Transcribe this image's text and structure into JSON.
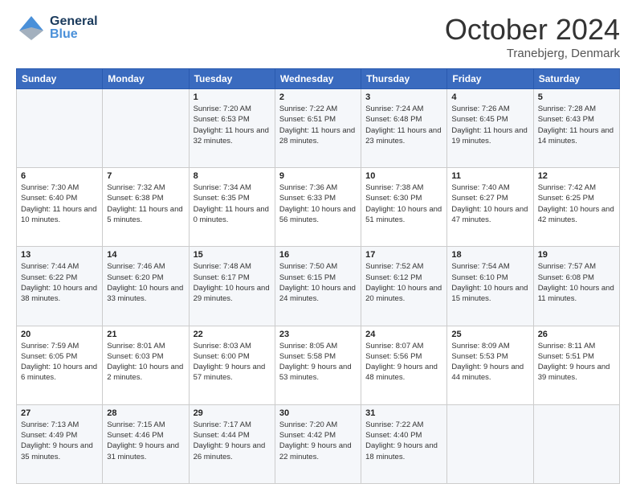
{
  "header": {
    "logo_general": "General",
    "logo_blue": "Blue",
    "month_title": "October 2024",
    "location": "Tranebjerg, Denmark"
  },
  "calendar": {
    "days_of_week": [
      "Sunday",
      "Monday",
      "Tuesday",
      "Wednesday",
      "Thursday",
      "Friday",
      "Saturday"
    ],
    "weeks": [
      [
        {
          "day": "",
          "sunrise": "",
          "sunset": "",
          "daylight": ""
        },
        {
          "day": "",
          "sunrise": "",
          "sunset": "",
          "daylight": ""
        },
        {
          "day": "1",
          "sunrise": "Sunrise: 7:20 AM",
          "sunset": "Sunset: 6:53 PM",
          "daylight": "Daylight: 11 hours and 32 minutes."
        },
        {
          "day": "2",
          "sunrise": "Sunrise: 7:22 AM",
          "sunset": "Sunset: 6:51 PM",
          "daylight": "Daylight: 11 hours and 28 minutes."
        },
        {
          "day": "3",
          "sunrise": "Sunrise: 7:24 AM",
          "sunset": "Sunset: 6:48 PM",
          "daylight": "Daylight: 11 hours and 23 minutes."
        },
        {
          "day": "4",
          "sunrise": "Sunrise: 7:26 AM",
          "sunset": "Sunset: 6:45 PM",
          "daylight": "Daylight: 11 hours and 19 minutes."
        },
        {
          "day": "5",
          "sunrise": "Sunrise: 7:28 AM",
          "sunset": "Sunset: 6:43 PM",
          "daylight": "Daylight: 11 hours and 14 minutes."
        }
      ],
      [
        {
          "day": "6",
          "sunrise": "Sunrise: 7:30 AM",
          "sunset": "Sunset: 6:40 PM",
          "daylight": "Daylight: 11 hours and 10 minutes."
        },
        {
          "day": "7",
          "sunrise": "Sunrise: 7:32 AM",
          "sunset": "Sunset: 6:38 PM",
          "daylight": "Daylight: 11 hours and 5 minutes."
        },
        {
          "day": "8",
          "sunrise": "Sunrise: 7:34 AM",
          "sunset": "Sunset: 6:35 PM",
          "daylight": "Daylight: 11 hours and 0 minutes."
        },
        {
          "day": "9",
          "sunrise": "Sunrise: 7:36 AM",
          "sunset": "Sunset: 6:33 PM",
          "daylight": "Daylight: 10 hours and 56 minutes."
        },
        {
          "day": "10",
          "sunrise": "Sunrise: 7:38 AM",
          "sunset": "Sunset: 6:30 PM",
          "daylight": "Daylight: 10 hours and 51 minutes."
        },
        {
          "day": "11",
          "sunrise": "Sunrise: 7:40 AM",
          "sunset": "Sunset: 6:27 PM",
          "daylight": "Daylight: 10 hours and 47 minutes."
        },
        {
          "day": "12",
          "sunrise": "Sunrise: 7:42 AM",
          "sunset": "Sunset: 6:25 PM",
          "daylight": "Daylight: 10 hours and 42 minutes."
        }
      ],
      [
        {
          "day": "13",
          "sunrise": "Sunrise: 7:44 AM",
          "sunset": "Sunset: 6:22 PM",
          "daylight": "Daylight: 10 hours and 38 minutes."
        },
        {
          "day": "14",
          "sunrise": "Sunrise: 7:46 AM",
          "sunset": "Sunset: 6:20 PM",
          "daylight": "Daylight: 10 hours and 33 minutes."
        },
        {
          "day": "15",
          "sunrise": "Sunrise: 7:48 AM",
          "sunset": "Sunset: 6:17 PM",
          "daylight": "Daylight: 10 hours and 29 minutes."
        },
        {
          "day": "16",
          "sunrise": "Sunrise: 7:50 AM",
          "sunset": "Sunset: 6:15 PM",
          "daylight": "Daylight: 10 hours and 24 minutes."
        },
        {
          "day": "17",
          "sunrise": "Sunrise: 7:52 AM",
          "sunset": "Sunset: 6:12 PM",
          "daylight": "Daylight: 10 hours and 20 minutes."
        },
        {
          "day": "18",
          "sunrise": "Sunrise: 7:54 AM",
          "sunset": "Sunset: 6:10 PM",
          "daylight": "Daylight: 10 hours and 15 minutes."
        },
        {
          "day": "19",
          "sunrise": "Sunrise: 7:57 AM",
          "sunset": "Sunset: 6:08 PM",
          "daylight": "Daylight: 10 hours and 11 minutes."
        }
      ],
      [
        {
          "day": "20",
          "sunrise": "Sunrise: 7:59 AM",
          "sunset": "Sunset: 6:05 PM",
          "daylight": "Daylight: 10 hours and 6 minutes."
        },
        {
          "day": "21",
          "sunrise": "Sunrise: 8:01 AM",
          "sunset": "Sunset: 6:03 PM",
          "daylight": "Daylight: 10 hours and 2 minutes."
        },
        {
          "day": "22",
          "sunrise": "Sunrise: 8:03 AM",
          "sunset": "Sunset: 6:00 PM",
          "daylight": "Daylight: 9 hours and 57 minutes."
        },
        {
          "day": "23",
          "sunrise": "Sunrise: 8:05 AM",
          "sunset": "Sunset: 5:58 PM",
          "daylight": "Daylight: 9 hours and 53 minutes."
        },
        {
          "day": "24",
          "sunrise": "Sunrise: 8:07 AM",
          "sunset": "Sunset: 5:56 PM",
          "daylight": "Daylight: 9 hours and 48 minutes."
        },
        {
          "day": "25",
          "sunrise": "Sunrise: 8:09 AM",
          "sunset": "Sunset: 5:53 PM",
          "daylight": "Daylight: 9 hours and 44 minutes."
        },
        {
          "day": "26",
          "sunrise": "Sunrise: 8:11 AM",
          "sunset": "Sunset: 5:51 PM",
          "daylight": "Daylight: 9 hours and 39 minutes."
        }
      ],
      [
        {
          "day": "27",
          "sunrise": "Sunrise: 7:13 AM",
          "sunset": "Sunset: 4:49 PM",
          "daylight": "Daylight: 9 hours and 35 minutes."
        },
        {
          "day": "28",
          "sunrise": "Sunrise: 7:15 AM",
          "sunset": "Sunset: 4:46 PM",
          "daylight": "Daylight: 9 hours and 31 minutes."
        },
        {
          "day": "29",
          "sunrise": "Sunrise: 7:17 AM",
          "sunset": "Sunset: 4:44 PM",
          "daylight": "Daylight: 9 hours and 26 minutes."
        },
        {
          "day": "30",
          "sunrise": "Sunrise: 7:20 AM",
          "sunset": "Sunset: 4:42 PM",
          "daylight": "Daylight: 9 hours and 22 minutes."
        },
        {
          "day": "31",
          "sunrise": "Sunrise: 7:22 AM",
          "sunset": "Sunset: 4:40 PM",
          "daylight": "Daylight: 9 hours and 18 minutes."
        },
        {
          "day": "",
          "sunrise": "",
          "sunset": "",
          "daylight": ""
        },
        {
          "day": "",
          "sunrise": "",
          "sunset": "",
          "daylight": ""
        }
      ]
    ]
  }
}
